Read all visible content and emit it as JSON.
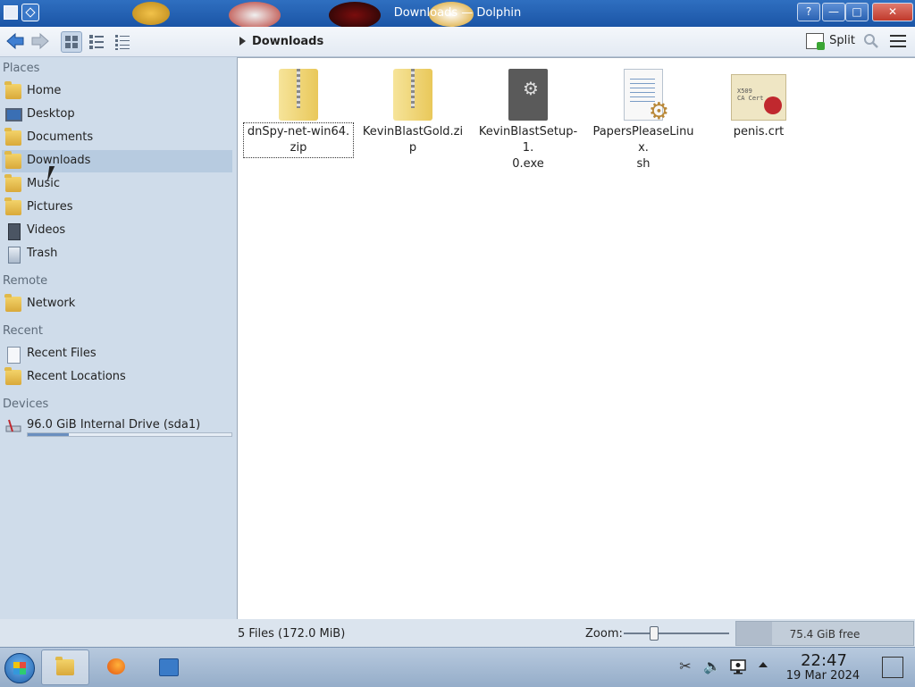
{
  "window": {
    "title": "Downloads — Dolphin"
  },
  "window_controls": {
    "help": "?",
    "minimize": "—",
    "maximize": "□",
    "close": "✕"
  },
  "toolbar": {
    "breadcrumb": "Downloads",
    "split_label": "Split"
  },
  "sidebar": {
    "sections": [
      {
        "title": "Places",
        "items": [
          {
            "label": "Home",
            "icon": "home-folder-icon"
          },
          {
            "label": "Desktop",
            "icon": "desktop-icon"
          },
          {
            "label": "Documents",
            "icon": "documents-folder-icon"
          },
          {
            "label": "Downloads",
            "icon": "downloads-folder-icon",
            "selected": true
          },
          {
            "label": "Music",
            "icon": "music-folder-icon"
          },
          {
            "label": "Pictures",
            "icon": "pictures-folder-icon"
          },
          {
            "label": "Videos",
            "icon": "videos-folder-icon"
          },
          {
            "label": "Trash",
            "icon": "trash-icon"
          }
        ]
      },
      {
        "title": "Remote",
        "items": [
          {
            "label": "Network",
            "icon": "network-folder-icon"
          }
        ]
      },
      {
        "title": "Recent",
        "items": [
          {
            "label": "Recent Files",
            "icon": "recent-files-icon"
          },
          {
            "label": "Recent Locations",
            "icon": "recent-locations-icon"
          }
        ]
      },
      {
        "title": "Devices",
        "items": [
          {
            "label": "96.0 GiB Internal Drive (sda1)",
            "icon": "hard-drive-icon",
            "usage_fraction": 0.2
          }
        ]
      }
    ]
  },
  "files": [
    {
      "name": "dnSpy-net-win64.zip",
      "line1": "dnSpy-net-win64.",
      "line2": "zip",
      "type": "zip",
      "selected": true
    },
    {
      "name": "KevinBlastGold.zip",
      "line1": "KevinBlastGold.zip",
      "line2": "",
      "type": "zip"
    },
    {
      "name": "KevinBlastSetup-1.0.exe",
      "line1": "KevinBlastSetup-1.",
      "line2": "0.exe",
      "type": "exe"
    },
    {
      "name": "PapersPleaseLinux.sh",
      "line1": "PapersPleaseLinux.",
      "line2": "sh",
      "type": "sh"
    },
    {
      "name": "penis.crt",
      "line1": "penis.crt",
      "line2": "",
      "type": "crt"
    }
  ],
  "certificate_icon_text": {
    "line1": "X509",
    "line2": "CA Cert"
  },
  "statusbar": {
    "summary": "5 Files (172.0 MiB)",
    "zoom_label": "Zoom:",
    "zoom_fraction": 0.28,
    "free_space": "75.4 GiB free",
    "used_fraction": 0.2
  },
  "taskbar": {
    "tasks": [
      {
        "name": "file-manager-task",
        "active": true
      },
      {
        "name": "firefox-task"
      },
      {
        "name": "system-settings-task"
      }
    ],
    "clock": {
      "time": "22:47",
      "date": "19 Mar 2024"
    }
  },
  "colors": {
    "titlebar": "#1b55a6",
    "selection": "#b7cbe0",
    "sidebar": "#cfdcea"
  }
}
